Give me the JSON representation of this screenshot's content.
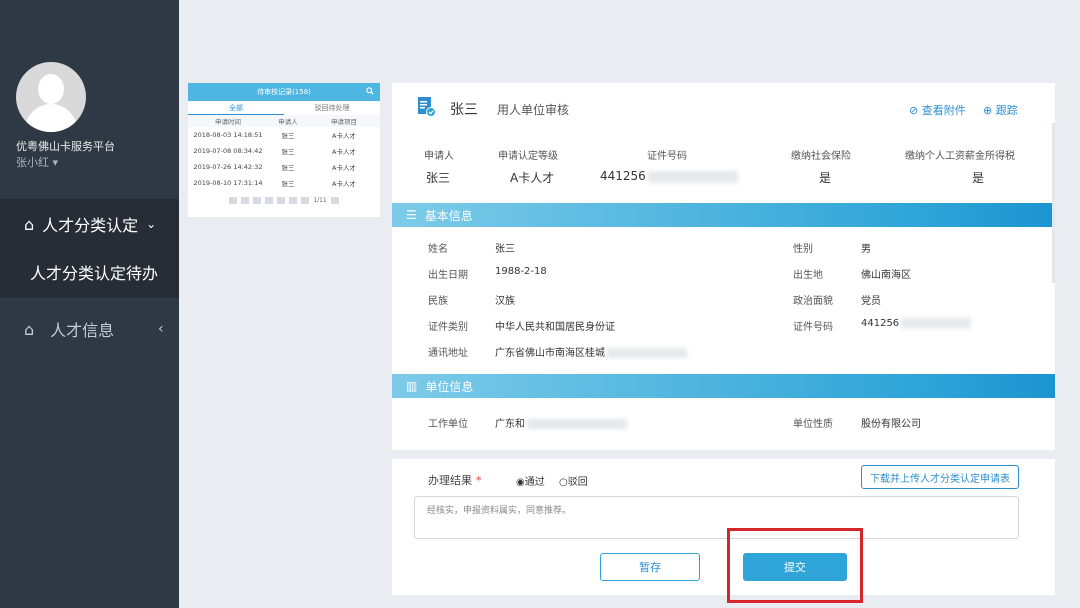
{
  "sidebar": {
    "platform_name": "优粤佛山卡服务平台",
    "username": "张小红",
    "menu_main": "人才分类认定",
    "menu_sub": "人才分类认定待办",
    "menu_info": "人才信息"
  },
  "list_panel": {
    "title": "待审核记录(158)",
    "tabs": [
      "全部",
      "驳回待处理"
    ],
    "columns": [
      "申请时间",
      "申请人",
      "申请项目"
    ],
    "rows": [
      {
        "time": "2018-08-03 14:18:51",
        "name": "张三",
        "project": "A卡人才"
      },
      {
        "time": "2019-07-08 08:34:42",
        "name": "张三",
        "project": "A卡人才"
      },
      {
        "time": "2019-07-26 14:42:32",
        "name": "张三",
        "project": "A卡人才"
      },
      {
        "time": "2019-08-10 17:31:14",
        "name": "张三",
        "project": "A卡人才"
      }
    ],
    "pager_text": "1/11"
  },
  "header": {
    "applicant_name": "张三",
    "title": "用人单位审核",
    "view_attachment": "查看附件",
    "track": "跟踪"
  },
  "summary": {
    "labels": [
      "申请人",
      "申请认定等级",
      "证件号码",
      "缴纳社会保险",
      "缴纳个人工资薪金所得税"
    ],
    "applicant": "张三",
    "level": "A卡人才",
    "id_prefix": "441256",
    "social_insurance": "是",
    "income_tax": "是"
  },
  "basic_info": {
    "section_title": "基本信息",
    "name_label": "姓名",
    "name": "张三",
    "gender_label": "性别",
    "gender": "男",
    "birth_label": "出生日期",
    "birth": "1988-2-18",
    "birthplace_label": "出生地",
    "birthplace": "佛山南海区",
    "ethnicity_label": "民族",
    "ethnicity": "汉族",
    "politics_label": "政治面貌",
    "politics": "党员",
    "id_type_label": "证件类别",
    "id_type": "中华人民共和国居民身份证",
    "id_no_label": "证件号码",
    "id_no": "441256",
    "address_label": "通讯地址",
    "address": "广东省佛山市南海区桂城"
  },
  "unit_info": {
    "section_title": "单位信息",
    "work_unit_label": "工作单位",
    "work_unit": "广东和",
    "unit_nature_label": "单位性质",
    "unit_nature": "股份有限公司"
  },
  "result": {
    "label": "办理结果",
    "required_mark": "*",
    "option_pass": "通过",
    "option_reject": "驳回",
    "download_btn": "下载并上传人才分类认定申请表",
    "comment": "经核实，申报资料属实，同意推荐。",
    "save_btn": "暂存",
    "submit_btn": "提交"
  },
  "colors": {
    "sidebar_bg": "#2f3945",
    "accent": "#2ea4d8",
    "highlight": "#d4262b"
  }
}
